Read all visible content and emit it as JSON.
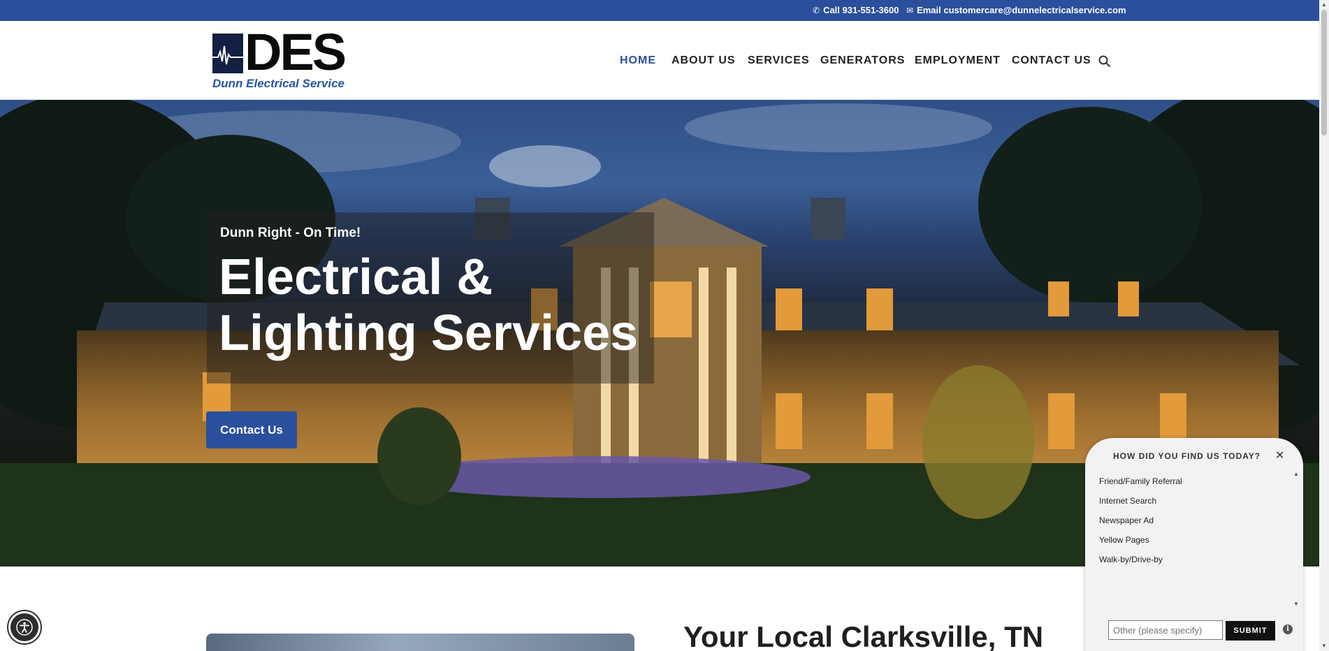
{
  "topbar": {
    "phone_icon": "phone-icon",
    "phone": "Call 931-551-3600",
    "email_icon": "envelope-icon",
    "email": "Email customercare@dunnelectricalservice.com"
  },
  "logo": {
    "letters": "DES",
    "tagline": "Dunn Electrical Service"
  },
  "nav": {
    "items": [
      {
        "label": "HOME"
      },
      {
        "label": "ABOUT US"
      },
      {
        "label": "SERVICES"
      },
      {
        "label": "GENERATORS"
      },
      {
        "label": "EMPLOYMENT"
      },
      {
        "label": "CONTACT US"
      }
    ],
    "search_icon": "search-icon"
  },
  "hero": {
    "kicker": "Dunn Right - On Time!",
    "headline_line1": "Electrical &",
    "headline_line2": "Lighting Services",
    "cta_label": "Contact Us"
  },
  "section": {
    "title": "Your Local Clarksville, TN"
  },
  "survey": {
    "question": "HOW DID YOU FIND US TODAY?",
    "close_icon": "close-icon",
    "options": [
      "Friend/Family Referral",
      "Internet Search",
      "Newspaper Ad",
      "Yellow Pages",
      "Walk-by/Drive-by"
    ],
    "other_placeholder": "Other (please specify)",
    "submit_label": "SUBMIT",
    "info_icon": "info-icon"
  },
  "accessibility": {
    "icon": "accessibility-icon"
  },
  "colors": {
    "brand_blue": "#2b4f9d",
    "text_dark": "#222222"
  }
}
